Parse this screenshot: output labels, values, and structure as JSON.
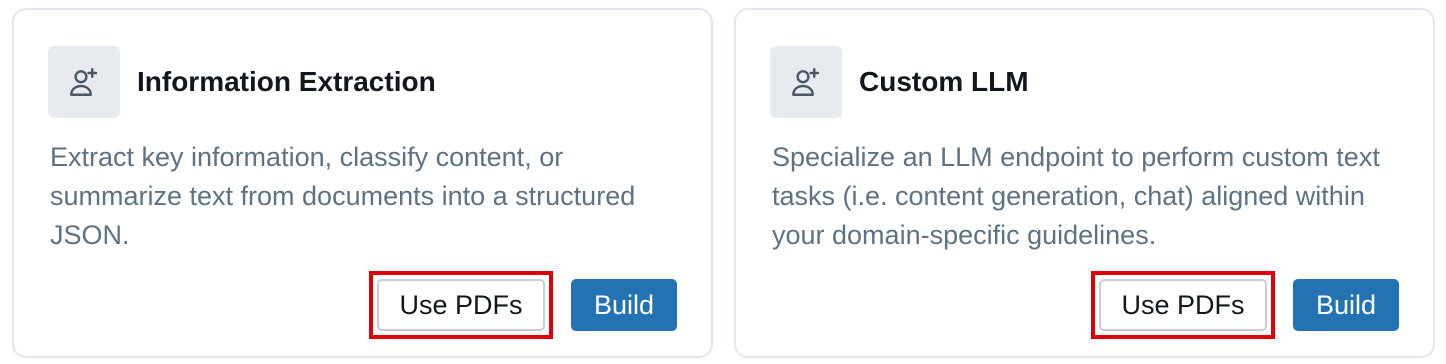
{
  "cards": [
    {
      "icon": "user-plus-icon",
      "title": "Information Extraction",
      "description": "Extract key information, classify content, or summarize text from documents into a structured JSON.",
      "secondary_button": "Use PDFs",
      "primary_button": "Build"
    },
    {
      "icon": "user-plus-icon",
      "title": "Custom LLM",
      "description": "Specialize an LLM endpoint to perform custom text tasks (i.e. content generation, chat) aligned within your domain-specific guidelines.",
      "secondary_button": "Use PDFs",
      "primary_button": "Build"
    }
  ],
  "colors": {
    "primary": "#2272b4",
    "highlight": "#e0000a",
    "icon_tile": "#e7ebef",
    "description_text": "#5d7283"
  }
}
